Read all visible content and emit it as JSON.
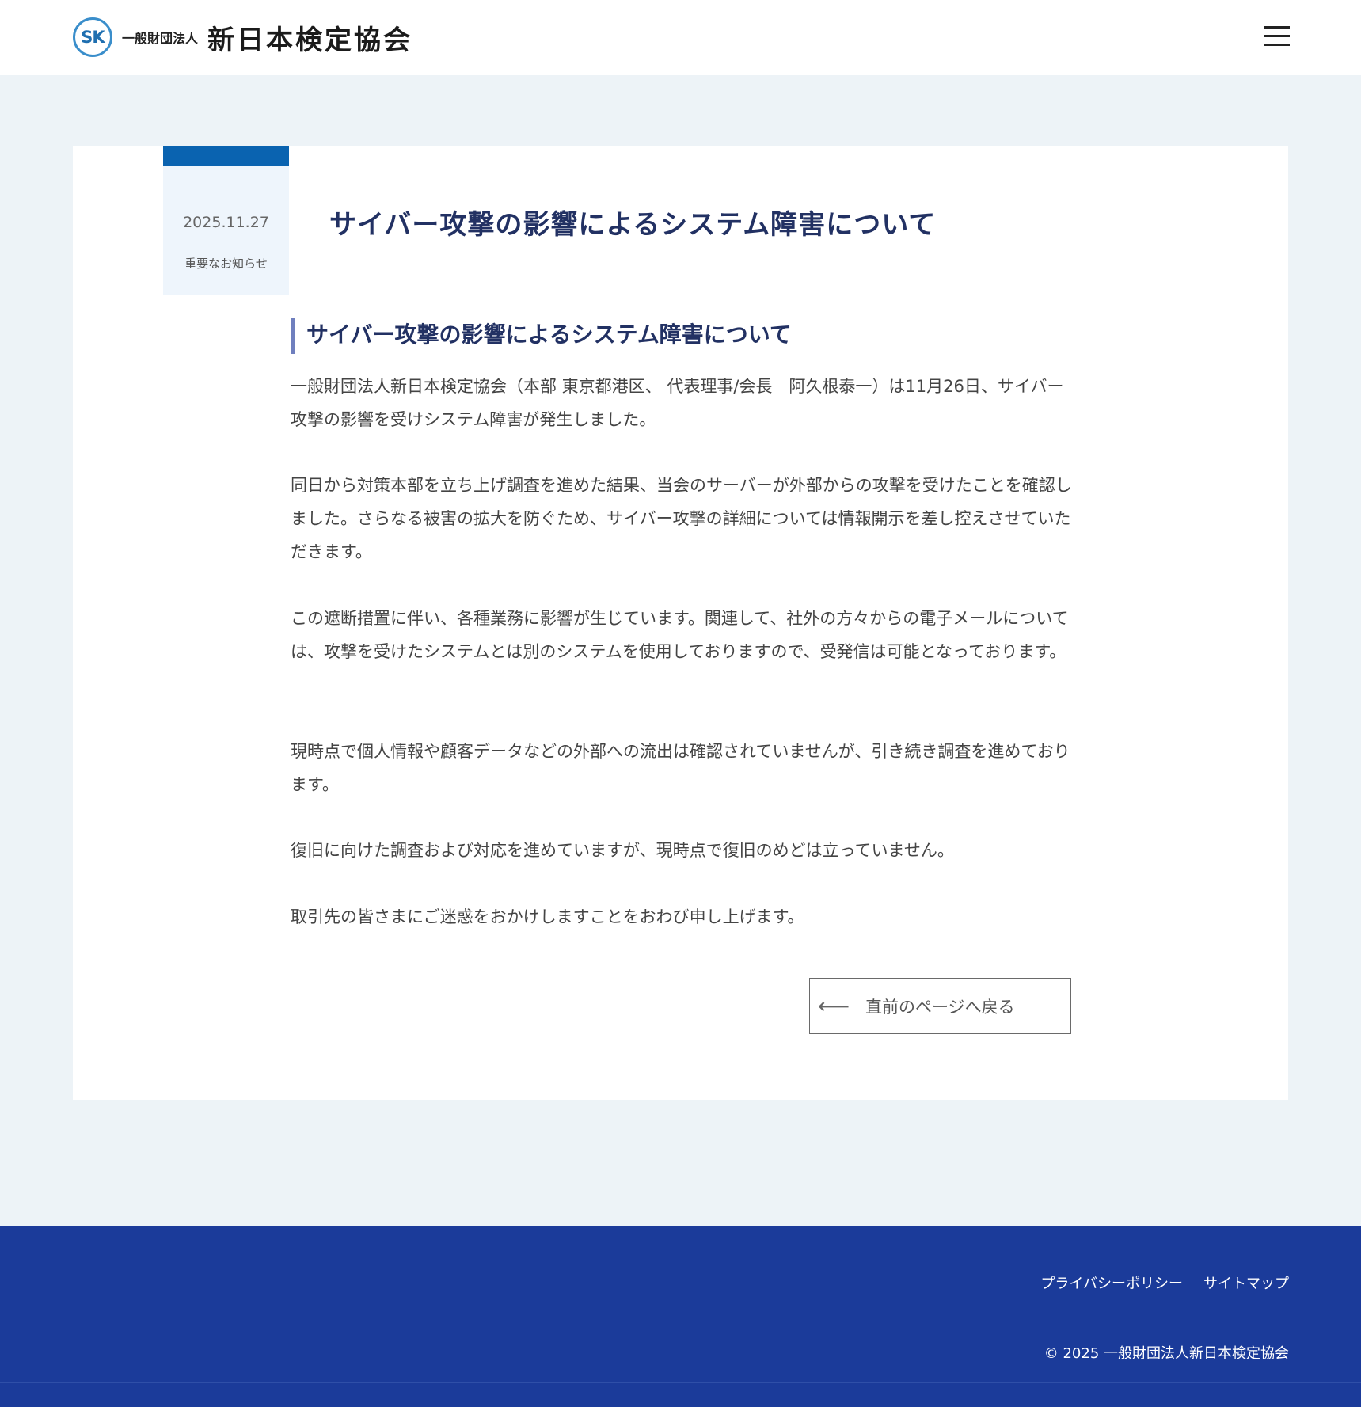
{
  "header": {
    "logo_mark": "SK",
    "logo_sub": "一般財団法人",
    "logo_main": "新日本検定協会"
  },
  "article": {
    "date": "2025.11.27",
    "category": "重要なお知らせ",
    "title": "サイバー攻撃の影響によるシステム障害について",
    "section_heading": "サイバー攻撃の影響によるシステム障害について",
    "paragraphs": [
      "一般財団法人新日本検定協会（本部 東京都港区、 代表理事/会長　阿久根泰一）は11月26日、サイバー攻撃の影響を受けシステム障害が発生しました。",
      "同日から対策本部を立ち上げ調査を進めた結果、当会のサーバーが外部からの攻撃を受けたことを確認しました。さらなる被害の拡大を防ぐため、サイバー攻撃の詳細については情報開示を差し控えさせていただきます。",
      "この遮断措置に伴い、各種業務に影響が生じています。関連して、社外の方々からの電子メールについては、攻撃を受けたシステムとは別のシステムを使用しておりますので、受発信は可能となっております。",
      "現時点で個人情報や顧客データなどの外部への流出は確認されていませんが、引き続き調査を進めております。",
      "復旧に向けた調査および対応を進めていますが、現時点で復旧のめどは立っていません。",
      "取引先の皆さまにご迷惑をおかけしますことをおわび申し上げます。"
    ],
    "back_arrow": "⟵",
    "back_label": "直前のページへ戻る"
  },
  "footer": {
    "links": [
      "プライバシーポリシー",
      "サイトマップ"
    ],
    "copyright": "© 2025 一般財団法人新日本検定協会"
  },
  "colors": {
    "accent_blue": "#0a63b0",
    "title_navy": "#223163",
    "footer_bg": "#1b3b9a",
    "page_bg": "#edf3f7"
  }
}
